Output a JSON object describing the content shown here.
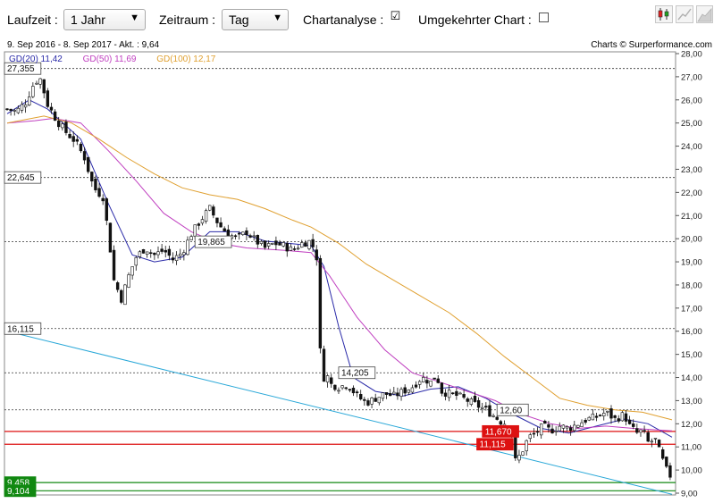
{
  "toolbar": {
    "laufzeit_label": "Laufzeit :",
    "laufzeit_value": "1 Jahr",
    "zeitraum_label": "Zeitraum :",
    "zeitraum_value": "Tag",
    "chartanalyse_label": "Chartanalyse :",
    "chartanalyse_checked": "☑",
    "umgekehrt_label": "Umgekehrter Chart :",
    "icons": [
      "candlestick-chart-icon",
      "line-chart-icon",
      "area-chart-icon"
    ]
  },
  "info": {
    "range": "9. Sep 2016 - 8. Sep 2017 - Akt. : 9,64",
    "credit": "Charts © Surperformance.com"
  },
  "legend": [
    {
      "label": "GD(20)",
      "value": "11,42",
      "color": "#2a2aa8"
    },
    {
      "label": "GD(50)",
      "value": "11,69",
      "color": "#c040c0"
    },
    {
      "label": "GD(100)",
      "value": "12,17",
      "color": "#e0a030"
    }
  ],
  "chart_data": {
    "type": "candlestick",
    "ylim": [
      9.0,
      28.0
    ],
    "y_ticks": [
      "9,00",
      "10,00",
      "11,00",
      "12,00",
      "13,00",
      "14,00",
      "15,00",
      "16,00",
      "17,00",
      "18,00",
      "19,00",
      "20,00",
      "21,00",
      "22,00",
      "23,00",
      "24,00",
      "25,00",
      "26,00",
      "27,00",
      "28,00"
    ],
    "y_tick_values": [
      9,
      10,
      11,
      12,
      13,
      14,
      15,
      16,
      17,
      18,
      19,
      20,
      21,
      22,
      23,
      24,
      25,
      26,
      27,
      28
    ],
    "date_range": [
      "9. Sep 2016",
      "8. Sep 2017"
    ],
    "last_price": 9.64,
    "close_path": [
      [
        0,
        25.6
      ],
      [
        5,
        25.5
      ],
      [
        10,
        25.9
      ],
      [
        15,
        26.8
      ],
      [
        18,
        26.9
      ],
      [
        22,
        25.8
      ],
      [
        27,
        25.1
      ],
      [
        32,
        24.6
      ],
      [
        37,
        24.2
      ],
      [
        42,
        23.5
      ],
      [
        47,
        22.2
      ],
      [
        52,
        21.8
      ],
      [
        55,
        20.2
      ],
      [
        58,
        18.2
      ],
      [
        62,
        17.4
      ],
      [
        66,
        18.4
      ],
      [
        70,
        19.2
      ],
      [
        75,
        19.6
      ],
      [
        80,
        19.3
      ],
      [
        85,
        19.5
      ],
      [
        90,
        19.1
      ],
      [
        95,
        19.4
      ],
      [
        100,
        20.2
      ],
      [
        105,
        20.8
      ],
      [
        110,
        21.3
      ],
      [
        115,
        20.6
      ],
      [
        120,
        20.2
      ],
      [
        125,
        20.0
      ],
      [
        130,
        20.3
      ],
      [
        135,
        19.9
      ],
      [
        140,
        19.6
      ],
      [
        145,
        19.8
      ],
      [
        150,
        19.7
      ],
      [
        155,
        19.5
      ],
      [
        160,
        19.8
      ],
      [
        165,
        19.9
      ],
      [
        168,
        19.2
      ],
      [
        169,
        16.5
      ],
      [
        171,
        13.8
      ],
      [
        173,
        14.2
      ],
      [
        176,
        13.7
      ],
      [
        180,
        13.6
      ],
      [
        185,
        13.7
      ],
      [
        190,
        13.2
      ],
      [
        195,
        12.9
      ],
      [
        200,
        13.1
      ],
      [
        205,
        13.3
      ],
      [
        210,
        13.2
      ],
      [
        215,
        13.4
      ],
      [
        220,
        13.6
      ],
      [
        225,
        14.0
      ],
      [
        230,
        13.8
      ],
      [
        233,
        14.1
      ],
      [
        236,
        13.4
      ],
      [
        240,
        13.3
      ],
      [
        245,
        13.2
      ],
      [
        250,
        13.0
      ],
      [
        255,
        12.8
      ],
      [
        260,
        12.6
      ],
      [
        265,
        12.3
      ],
      [
        268,
        12.1
      ],
      [
        271,
        12.0
      ],
      [
        274,
        11.6
      ],
      [
        276,
        10.4
      ],
      [
        279,
        10.7
      ],
      [
        283,
        11.4
      ],
      [
        287,
        11.6
      ],
      [
        291,
        11.9
      ],
      [
        295,
        11.7
      ],
      [
        300,
        11.9
      ],
      [
        305,
        11.8
      ],
      [
        310,
        12.0
      ],
      [
        315,
        12.2
      ],
      [
        320,
        12.3
      ],
      [
        325,
        12.5
      ],
      [
        330,
        12.2
      ],
      [
        335,
        12.4
      ],
      [
        338,
        11.9
      ],
      [
        342,
        11.6
      ],
      [
        345,
        11.7
      ],
      [
        348,
        11.2
      ],
      [
        352,
        11.3
      ],
      [
        355,
        10.6
      ],
      [
        358,
        10.0
      ],
      [
        361,
        9.64
      ]
    ],
    "ma_series": [
      {
        "name": "GD(20)",
        "color": "#2a2aa8",
        "points": [
          [
            0,
            25.4
          ],
          [
            12,
            26.0
          ],
          [
            22,
            25.6
          ],
          [
            40,
            24.3
          ],
          [
            55,
            21.5
          ],
          [
            68,
            19.3
          ],
          [
            80,
            19.0
          ],
          [
            95,
            19.2
          ],
          [
            110,
            20.3
          ],
          [
            125,
            20.3
          ],
          [
            140,
            19.9
          ],
          [
            165,
            19.7
          ],
          [
            172,
            18.8
          ],
          [
            180,
            16.2
          ],
          [
            188,
            14.0
          ],
          [
            200,
            13.4
          ],
          [
            215,
            13.2
          ],
          [
            230,
            13.5
          ],
          [
            245,
            13.6
          ],
          [
            260,
            13.1
          ],
          [
            275,
            12.4
          ],
          [
            290,
            11.8
          ],
          [
            305,
            11.6
          ],
          [
            320,
            11.9
          ],
          [
            335,
            12.2
          ],
          [
            348,
            12.0
          ],
          [
            361,
            11.42
          ]
        ]
      },
      {
        "name": "GD(50)",
        "color": "#c040c0",
        "points": [
          [
            0,
            25.0
          ],
          [
            15,
            25.1
          ],
          [
            25,
            25.2
          ],
          [
            40,
            25.0
          ],
          [
            55,
            23.8
          ],
          [
            70,
            22.5
          ],
          [
            85,
            21.1
          ],
          [
            100,
            20.3
          ],
          [
            115,
            19.8
          ],
          [
            130,
            19.6
          ],
          [
            150,
            19.5
          ],
          [
            165,
            19.4
          ],
          [
            175,
            18.4
          ],
          [
            190,
            16.6
          ],
          [
            205,
            15.2
          ],
          [
            220,
            14.2
          ],
          [
            235,
            13.8
          ],
          [
            250,
            13.4
          ],
          [
            265,
            13.0
          ],
          [
            280,
            12.4
          ],
          [
            295,
            12.0
          ],
          [
            310,
            11.8
          ],
          [
            325,
            11.9
          ],
          [
            340,
            11.8
          ],
          [
            361,
            11.69
          ]
        ]
      },
      {
        "name": "GD(100)",
        "color": "#e0a030",
        "points": [
          [
            0,
            25.0
          ],
          [
            20,
            25.3
          ],
          [
            35,
            25.0
          ],
          [
            50,
            24.3
          ],
          [
            65,
            23.5
          ],
          [
            80,
            22.8
          ],
          [
            95,
            22.2
          ],
          [
            110,
            21.9
          ],
          [
            125,
            21.7
          ],
          [
            140,
            21.3
          ],
          [
            155,
            20.8
          ],
          [
            165,
            20.5
          ],
          [
            180,
            19.8
          ],
          [
            195,
            18.9
          ],
          [
            210,
            18.2
          ],
          [
            225,
            17.5
          ],
          [
            240,
            16.8
          ],
          [
            255,
            15.9
          ],
          [
            270,
            14.9
          ],
          [
            285,
            14.0
          ],
          [
            300,
            13.1
          ],
          [
            315,
            12.8
          ],
          [
            330,
            12.6
          ],
          [
            345,
            12.5
          ],
          [
            361,
            12.17
          ]
        ]
      }
    ],
    "horizontal_levels": [
      {
        "label": "27,355",
        "value": 27.355,
        "style": "dashed",
        "color": "#333333",
        "box_x": 0.0
      },
      {
        "label": "22,645",
        "value": 22.645,
        "style": "dashed",
        "color": "#333333",
        "box_x": 0.0
      },
      {
        "label": "19,865",
        "value": 19.865,
        "style": "dashed",
        "color": "#333333",
        "box_x": 102
      },
      {
        "label": "16,115",
        "value": 16.115,
        "style": "dashed",
        "color": "#333333",
        "box_x": 0.0
      },
      {
        "label": "14,205",
        "value": 14.205,
        "style": "dashed",
        "color": "#333333",
        "box_x": 180
      },
      {
        "label": "12,60",
        "value": 12.6,
        "style": "dashed",
        "color": "#333333",
        "box_x": 266
      },
      {
        "label": "11,670",
        "value": 11.67,
        "style": "solid",
        "color": "#dd1111",
        "box_x": 258
      },
      {
        "label": "11,115",
        "value": 11.115,
        "style": "solid",
        "color": "#dd1111",
        "box_x": 255
      },
      {
        "label": "9,458",
        "value": 9.458,
        "style": "solid",
        "color": "#118811",
        "box_x": 0.0
      },
      {
        "label": "9,104",
        "value": 9.104,
        "style": "solid",
        "color": "#118811",
        "box_x": 0.0
      }
    ],
    "trendline": {
      "color": "#2aa8d8",
      "from": [
        0,
        16.0
      ],
      "to": [
        361,
        8.95
      ]
    }
  }
}
